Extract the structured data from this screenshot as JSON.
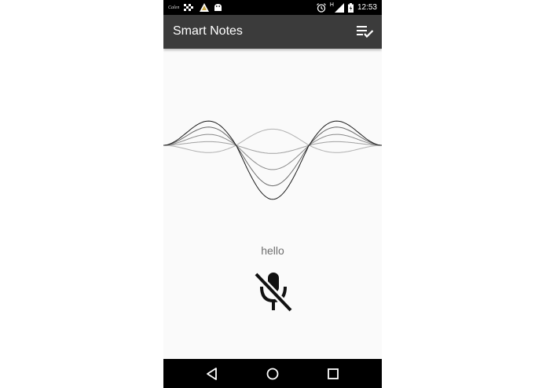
{
  "status_bar": {
    "notification_text": "Calen",
    "network_label": "H",
    "time": "12:53",
    "icons": [
      "calendar-notification-icon",
      "checkered-flag-icon",
      "warning-triangle-icon",
      "android-icon",
      "alarm-icon",
      "signal-icon",
      "battery-icon"
    ]
  },
  "app_bar": {
    "title": "Smart Notes",
    "action_icon": "playlist-check-icon"
  },
  "waveform": {
    "stroke_colors": [
      "#b0b0b0",
      "#a0a0a0",
      "#8a8a8a",
      "#6a6a6a",
      "#1a1a1a"
    ]
  },
  "main": {
    "transcript": "hello",
    "mic_icon": "mic-off-icon"
  },
  "nav_bar": {
    "buttons": [
      "back-icon",
      "home-icon",
      "recents-icon"
    ]
  }
}
